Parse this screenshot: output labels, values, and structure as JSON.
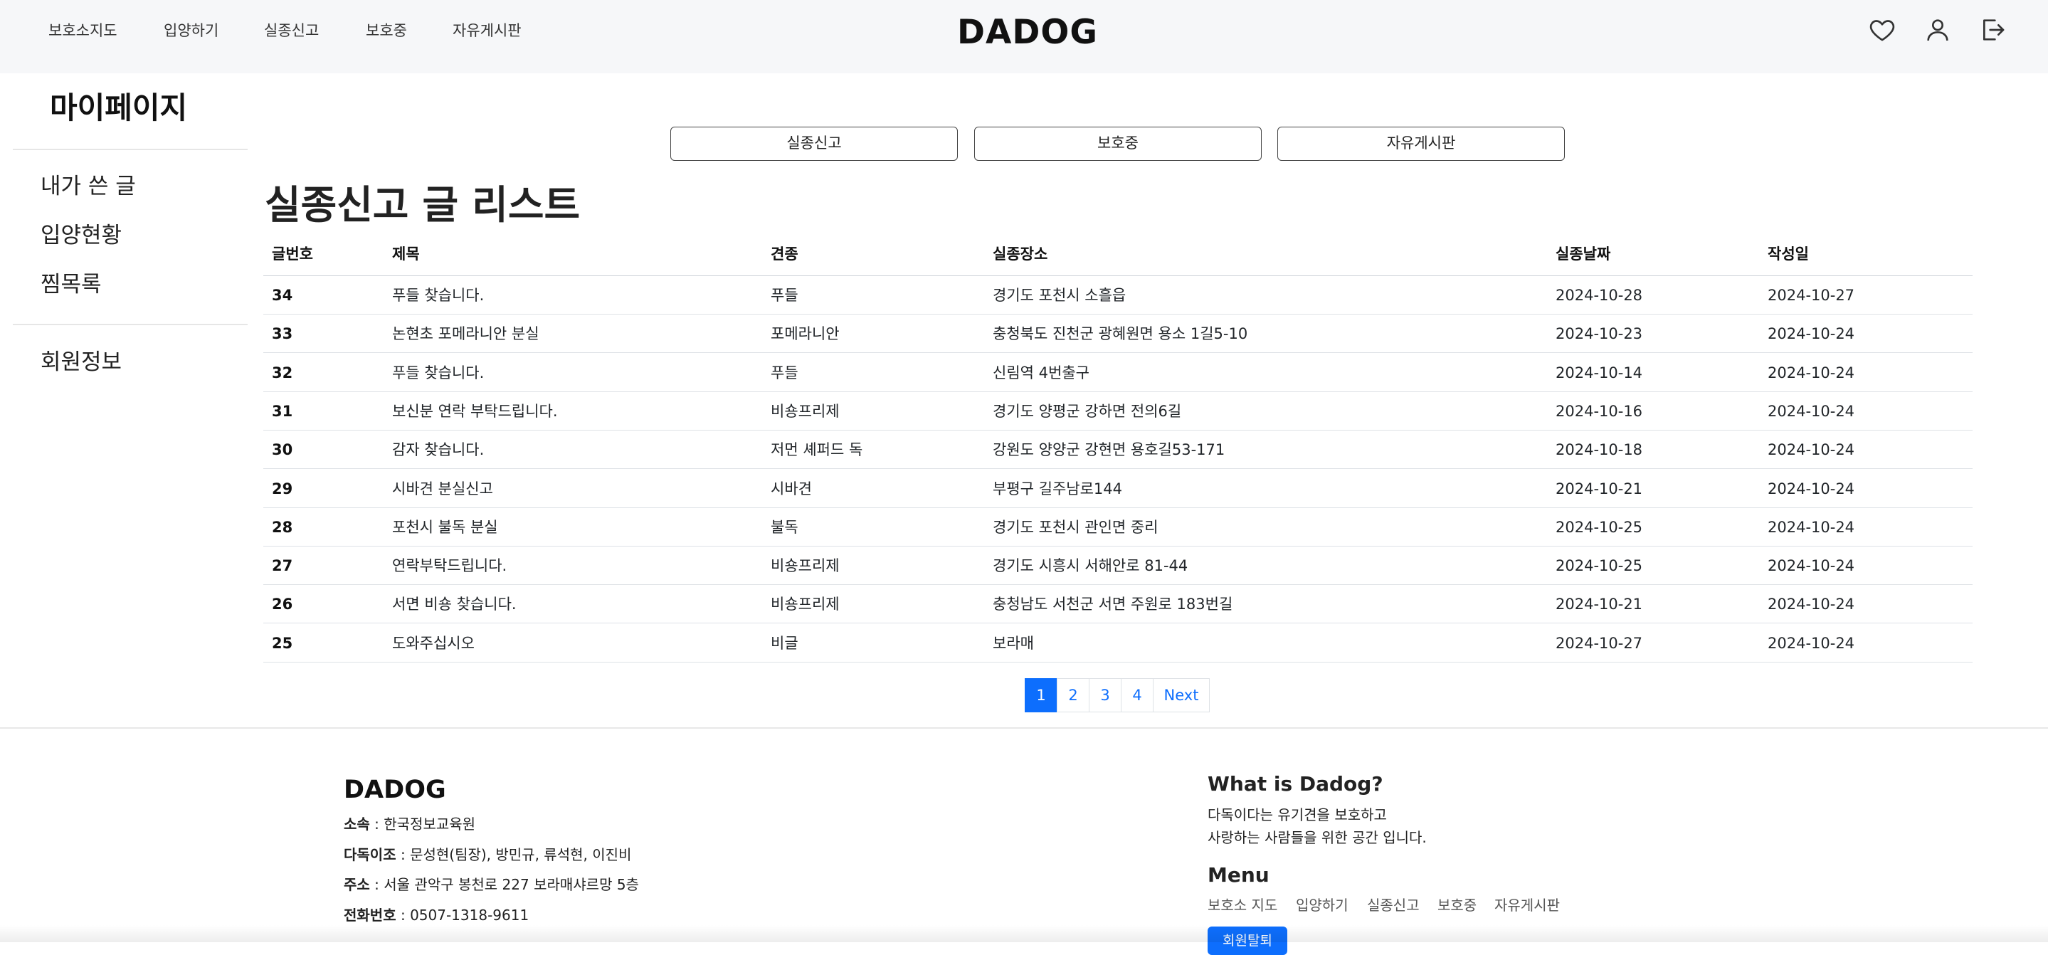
{
  "header": {
    "nav": [
      "보호소지도",
      "입양하기",
      "실종신고",
      "보호중",
      "자유게시판"
    ],
    "logo": "DADOG",
    "icons": [
      "heart-icon",
      "user-icon",
      "logout-icon"
    ]
  },
  "sidebar": {
    "title": "마이페이지",
    "items": [
      "내가 쓴 글",
      "입양현황",
      "찜목록"
    ],
    "items2": [
      "회원정보"
    ]
  },
  "tabs": [
    "실종신고",
    "보호중",
    "자유게시판"
  ],
  "list": {
    "heading": "실종신고 글 리스트",
    "columns": [
      "글번호",
      "제목",
      "견종",
      "실종장소",
      "실종날짜",
      "작성일"
    ],
    "rows": [
      [
        "34",
        "푸들 찾습니다.",
        "푸들",
        "경기도 포천시 소흘읍",
        "2024-10-28",
        "2024-10-27"
      ],
      [
        "33",
        "논현초 포메라니안 분실",
        "포메라니안",
        "충청북도 진천군 광혜원면 용소 1길5-10",
        "2024-10-23",
        "2024-10-24"
      ],
      [
        "32",
        "푸들 찾습니다.",
        "푸들",
        "신림역 4번출구",
        "2024-10-14",
        "2024-10-24"
      ],
      [
        "31",
        "보신분 연락 부탁드립니다.",
        "비숑프리제",
        "경기도 양평군 강하면 전의6길",
        "2024-10-16",
        "2024-10-24"
      ],
      [
        "30",
        "감자 찾습니다.",
        "저먼 셰퍼드 독",
        "강원도 양양군 강현면 용호길53-171",
        "2024-10-18",
        "2024-10-24"
      ],
      [
        "29",
        "시바견 분실신고",
        "시바견",
        "부평구 길주남로144",
        "2024-10-21",
        "2024-10-24"
      ],
      [
        "28",
        "포천시 불독 분실",
        "불독",
        "경기도 포천시 관인면 중리",
        "2024-10-25",
        "2024-10-24"
      ],
      [
        "27",
        "연락부탁드립니다.",
        "비숑프리제",
        "경기도 시흥시 서해안로 81-44",
        "2024-10-25",
        "2024-10-24"
      ],
      [
        "26",
        "서면 비숑 찾습니다.",
        "비숑프리제",
        "충청남도 서천군 서면 주원로 183번길",
        "2024-10-21",
        "2024-10-24"
      ],
      [
        "25",
        "도와주십시오",
        "비글",
        "보라매",
        "2024-10-27",
        "2024-10-24"
      ]
    ]
  },
  "pagination": {
    "pages": [
      "1",
      "2",
      "3",
      "4"
    ],
    "active": "1",
    "next": "Next"
  },
  "footer": {
    "logo": "DADOG",
    "info": [
      {
        "label": "소속",
        "value": " : 한국정보교육원"
      },
      {
        "label": "다독이조",
        "value": " : 문성현(팀장), 방민규, 류석현, 이진비"
      },
      {
        "label": "주소",
        "value": " : 서울 관악구 봉천로 227 보라매샤르망 5층"
      },
      {
        "label": "전화번호",
        "value": " : 0507-1318-9611"
      }
    ],
    "about_title": "What is Dadog?",
    "about_lines": [
      "다독이다는 유기견을 보호하고",
      "사랑하는 사람들을 위한 공간 입니다."
    ],
    "menu_title": "Menu",
    "menu": [
      "보호소 지도",
      "입양하기",
      "실종신고",
      "보호중",
      "자유게시판"
    ],
    "button": "회원탈퇴"
  },
  "colors": {
    "accent": "#0d6efd",
    "header_bg": "#f6f7f9"
  }
}
